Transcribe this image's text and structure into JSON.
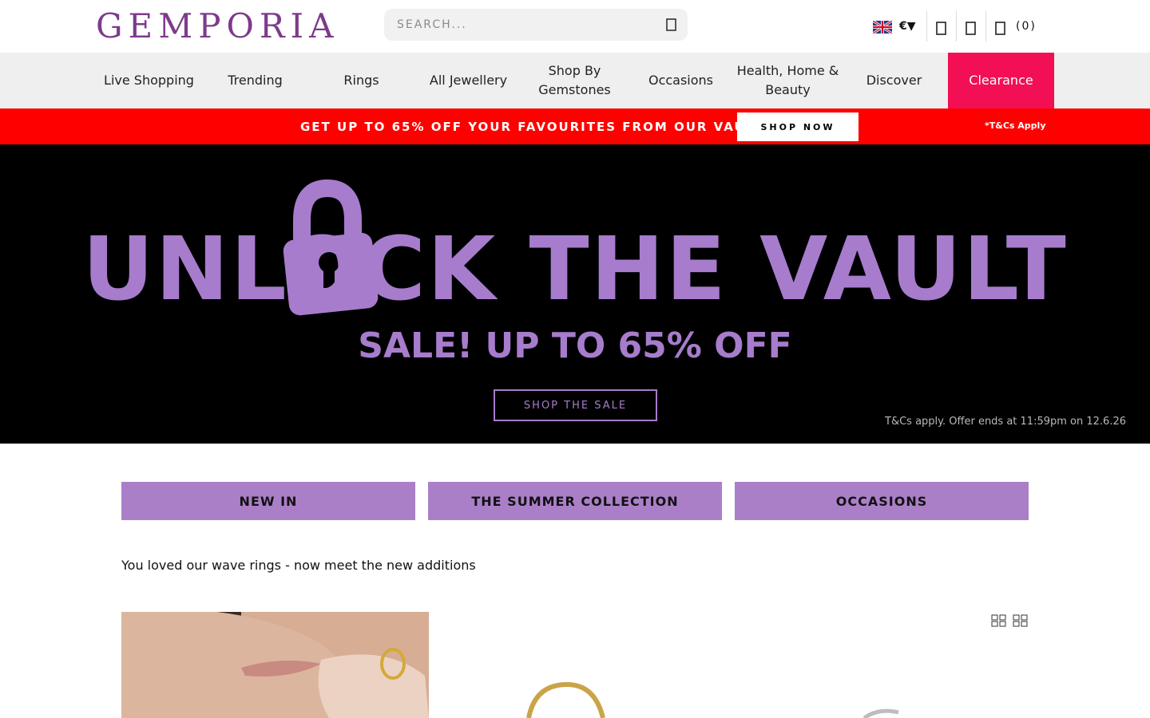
{
  "header": {
    "logo": "GEMPORIA",
    "search_placeholder": "SEARCH...",
    "currency": "€▼",
    "bag_count": "(0)",
    "icons": [
      "search-icon",
      "uk-flag-icon",
      "account-icon",
      "wishlist-icon",
      "bag-icon"
    ]
  },
  "nav": {
    "items": [
      {
        "label": "Live Shopping"
      },
      {
        "label": "Trending"
      },
      {
        "label": "Rings"
      },
      {
        "label": "All Jewellery"
      },
      {
        "label": "Shop By Gemstones"
      },
      {
        "label": "Occasions"
      },
      {
        "label": "Health, Home & Beauty"
      },
      {
        "label": "Discover"
      },
      {
        "label": "Clearance"
      }
    ]
  },
  "promo": {
    "text": "GET UP TO 65% OFF YOUR FAVOURITES FROM OUR VAULT!",
    "button": "SHOP NOW",
    "tcs": "*T&Cs Apply",
    "color": "#ff0000"
  },
  "hero": {
    "title": "UNLOCK THE VAULT",
    "subtitle": "SALE! UP TO 65% OFF",
    "button": "SHOP THE SALE",
    "tcs": "T&Cs apply. Offer ends at 11:59pm on 12.6.26",
    "accent": "#a77ccc"
  },
  "categories": [
    {
      "label": "NEW IN"
    },
    {
      "label": "THE SUMMER COLLECTION"
    },
    {
      "label": "OCCASIONS"
    }
  ],
  "intro": "You loved our wave rings - now meet the new additions",
  "colors": {
    "brand": "#7d3b8b",
    "clearance": "#f20f54",
    "category": "#ab7fc8"
  }
}
